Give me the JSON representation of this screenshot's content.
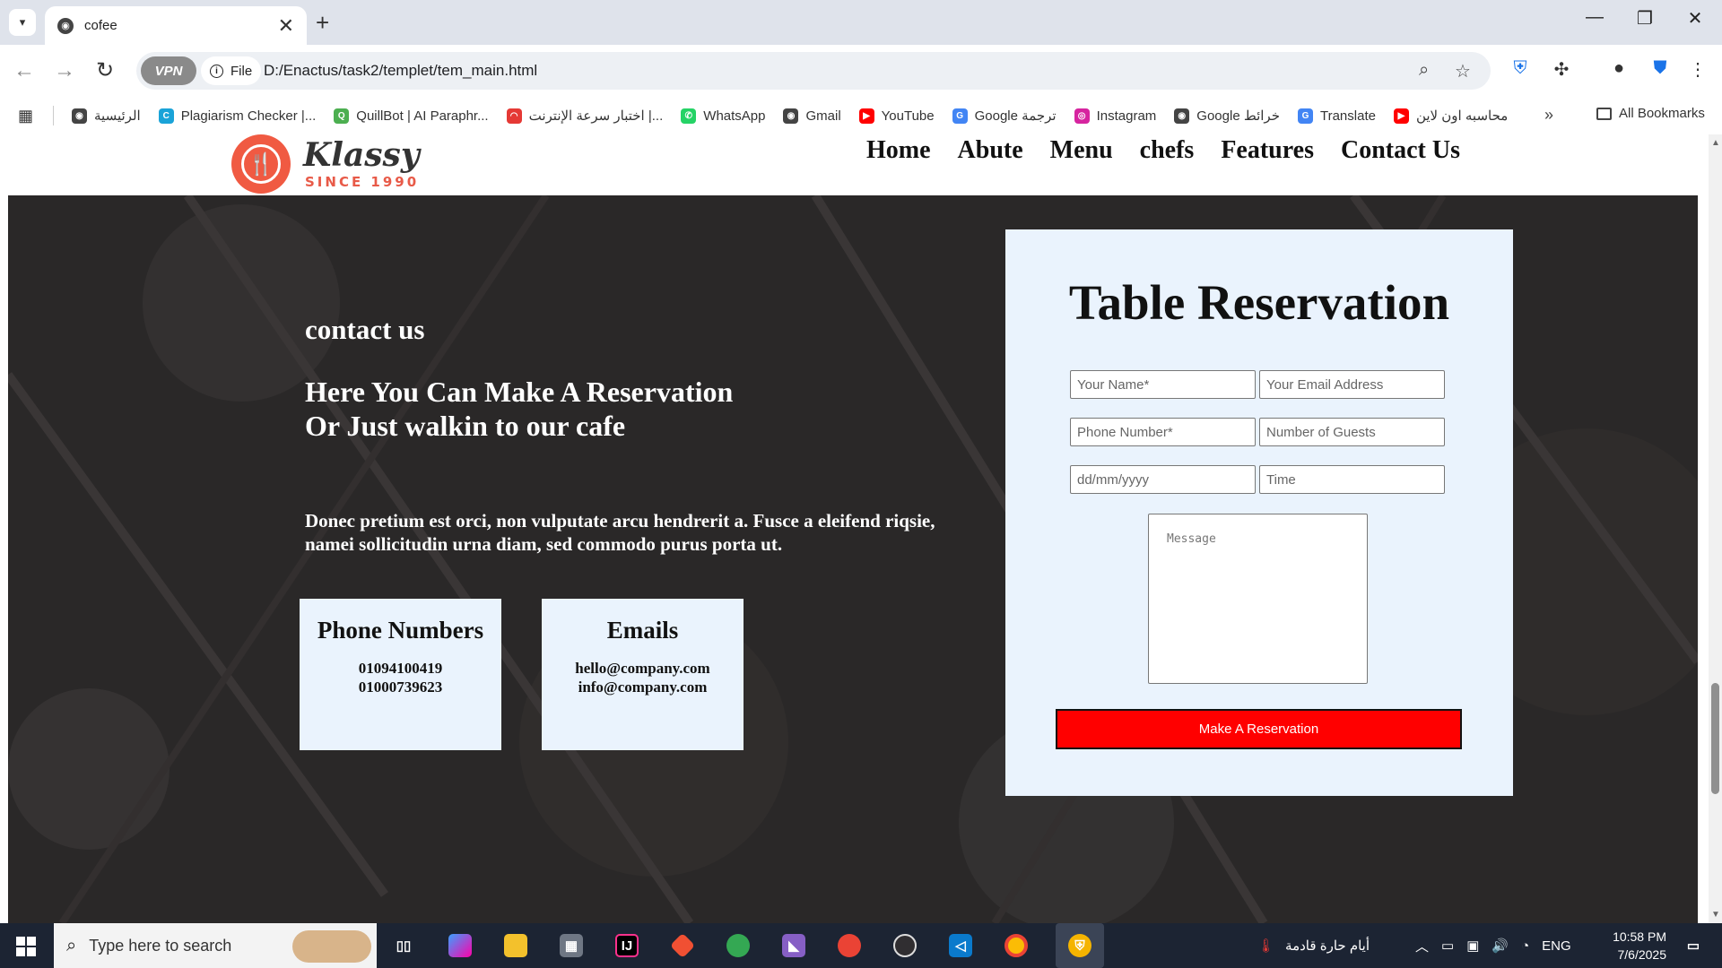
{
  "browser": {
    "tab_title": "cofee",
    "tab_close": "✕",
    "new_tab": "+",
    "window_controls": [
      "—",
      "❐",
      "✕"
    ],
    "back": "←",
    "forward": "→",
    "reload": "↻",
    "vpn_label": "VPN",
    "file_chip": "File",
    "url": "D:/Enactus/task2/templet/tem_main.html",
    "zoom_icon": "⌕",
    "star_icon": "☆",
    "menu_icon": "⋮"
  },
  "bookmarks": {
    "items": [
      {
        "label": "الرئيسية",
        "color": "#444444",
        "glyph": "◉"
      },
      {
        "label": "Plagiarism Checker |...",
        "color": "#1aa3d8",
        "glyph": "C"
      },
      {
        "label": "QuillBot | AI Paraphr...",
        "color": "#4caf50",
        "glyph": "Q"
      },
      {
        "label": "اختبار سرعة الإنترنت |...",
        "color": "#e53935",
        "glyph": "◠"
      },
      {
        "label": "WhatsApp",
        "color": "#25d366",
        "glyph": "✆"
      },
      {
        "label": "Gmail",
        "color": "#444444",
        "glyph": "◉"
      },
      {
        "label": "YouTube",
        "color": "#ff0000",
        "glyph": "▶"
      },
      {
        "label": "Google ترجمة",
        "color": "#4285f4",
        "glyph": "G"
      },
      {
        "label": "Instagram",
        "color": "#d6249f",
        "glyph": "◎"
      },
      {
        "label": "Google خرائط",
        "color": "#444444",
        "glyph": "◉"
      },
      {
        "label": "Translate",
        "color": "#4285f4",
        "glyph": "G"
      },
      {
        "label": "محاسبه اون لاين",
        "color": "#ff0000",
        "glyph": "▶"
      }
    ],
    "more": "»",
    "all_bookmarks": "All Bookmarks"
  },
  "site": {
    "logo_name": "Klassy",
    "logo_since": "SINCE 1990",
    "nav": [
      "Home",
      "Abute",
      "Menu",
      "chefs",
      "Features",
      "Contact Us"
    ]
  },
  "contact": {
    "kicker": "contact us",
    "heading_line1": "Here You Can Make A Reservation",
    "heading_line2": "Or Just walkin to our cafe",
    "body": "Donec pretium est orci, non vulputate arcu hendrerit a. Fusce a eleifend riqsie, namei sollicitudin urna diam, sed commodo purus porta ut.",
    "phone_card": {
      "title": "Phone Numbers",
      "lines": [
        "01094100419",
        "01000739623"
      ]
    },
    "email_card": {
      "title": "Emails",
      "lines": [
        "hello@company.com",
        "info@company.com"
      ]
    }
  },
  "reservation": {
    "title": "Table Reservation",
    "name_placeholder": "Your Name*",
    "email_placeholder": "Your Email Address",
    "phone_placeholder": "Phone Number*",
    "guests_placeholder": "Number of Guests",
    "date_placeholder": "dd/mm/yyyy",
    "time_placeholder": "Time",
    "message_placeholder": "Message",
    "submit_label": "Make A Reservation"
  },
  "taskbar": {
    "search_placeholder": "Type here to search",
    "weather_text": "أيام حارة قادمة",
    "language": "ENG",
    "time": "10:58 PM",
    "date": "7/6/2025"
  },
  "colors": {
    "accent_red": "#ff0000",
    "card_bg": "#eaf3fd",
    "hero_bg": "#2a2828",
    "logo_orange": "#f05a42"
  }
}
